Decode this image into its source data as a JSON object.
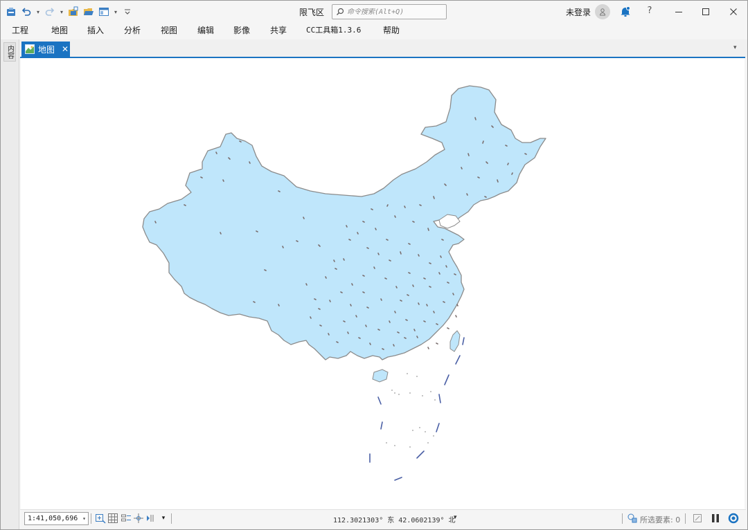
{
  "window": {
    "title": "限飞区",
    "search_placeholder": "命令搜索(Alt+Q)",
    "user_status": "未登录",
    "help_label": "?"
  },
  "quick_access": [
    {
      "icon": "project-icon"
    },
    {
      "icon": "undo-icon"
    },
    {
      "icon": "redo-icon"
    },
    {
      "icon": "new-project-icon"
    },
    {
      "icon": "open-project-icon"
    },
    {
      "icon": "view-layout-icon"
    },
    {
      "icon": "customize-qat-icon"
    }
  ],
  "menu": {
    "items": [
      "工程",
      "地图",
      "插入",
      "分析",
      "视图",
      "编辑",
      "影像",
      "共享",
      "CC工具箱1.3.6",
      "帮助"
    ]
  },
  "side_panel": {
    "tab_label": "内容"
  },
  "tabs": [
    {
      "label": "地图",
      "active": true,
      "close_glyph": "✕"
    }
  ],
  "status_bar": {
    "scale": "1:41,050,696",
    "coordinates": "112.3021303° 东 42.0602139° 北",
    "selected_features": "所选要素: 0"
  },
  "colors": {
    "accent": "#1a73c2",
    "land_fill": "#bfe6fb",
    "land_outline": "#8b8b8b",
    "boundary": "#4a5fa5",
    "marker": "#7a6e6e"
  }
}
